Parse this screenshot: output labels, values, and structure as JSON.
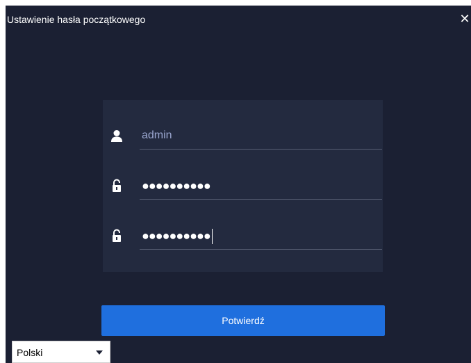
{
  "dialog": {
    "title": "Ustawienie hasła początkowego",
    "close_icon": "close-icon",
    "close_glyph": "✕"
  },
  "form": {
    "username": {
      "icon": "user-icon",
      "value": "admin"
    },
    "password": {
      "icon": "unlock-icon",
      "masked_value": "●●●●●●●●●●"
    },
    "confirm_password": {
      "icon": "unlock-icon",
      "masked_value": "●●●●●●●●●●"
    }
  },
  "confirm_button": {
    "label": "Potwierdź"
  },
  "language_select": {
    "selected": "Polski",
    "icon": "caret-down-icon"
  },
  "colors": {
    "dialog_bg": "#1b2033",
    "card_bg": "#232a3f",
    "accent": "#1f6fde",
    "username_text": "#9aa6cf"
  }
}
